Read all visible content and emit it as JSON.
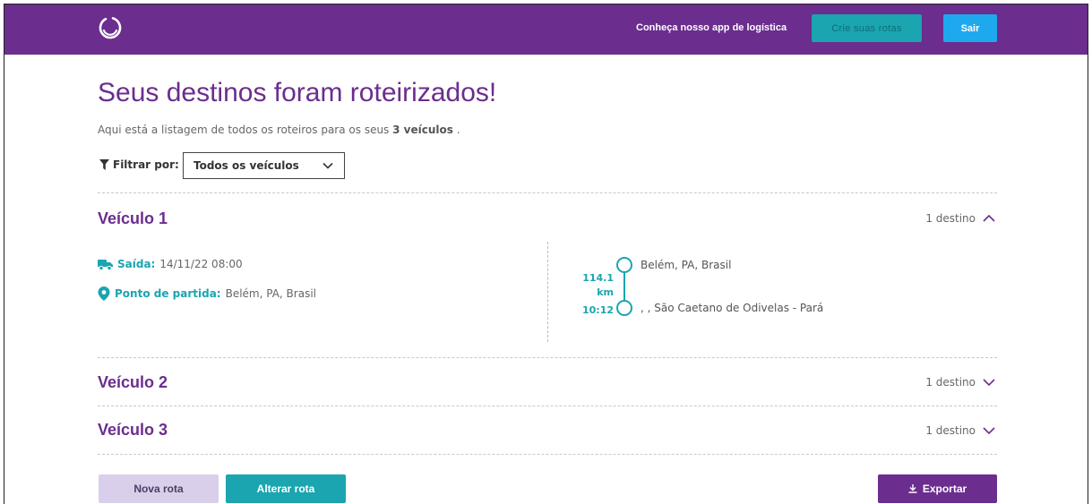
{
  "header": {
    "app_link": "Conheça nosso app de logística",
    "create_routes": "Crie suas rotas",
    "exit": "Sair",
    "brand_color": "#6b2d8e",
    "accent_color": "#1aa5b0"
  },
  "main": {
    "title": "Seus destinos foram roteirizados!",
    "subtitle_prefix": "Aqui está a listagem de todos os roteiros para os seus",
    "subtitle_count": "3 veículos",
    "subtitle_suffix": ".",
    "filter_label": "Filtrar por:",
    "filter_value": "Todos os veículos"
  },
  "vehicles": [
    {
      "name": "Veículo 1",
      "count": "1 destino",
      "expanded": true,
      "departure_label": "Saída:",
      "departure_value": "14/11/22 08:00",
      "start_label": "Ponto de partida:",
      "start_value": "Belém, PA, Brasil",
      "stops": [
        {
          "address": "Belém, PA, Brasil"
        },
        {
          "address": ", , São Caetano de Odivelas - Pará",
          "distance": "114.1",
          "distance_unit": "km",
          "eta": "10:12"
        }
      ]
    },
    {
      "name": "Veículo 2",
      "count": "1 destino",
      "expanded": false
    },
    {
      "name": "Veículo 3",
      "count": "1 destino",
      "expanded": false
    }
  ],
  "footer": {
    "new_route": "Nova rota",
    "alter_route": "Alterar rota",
    "export": "Exportar"
  }
}
